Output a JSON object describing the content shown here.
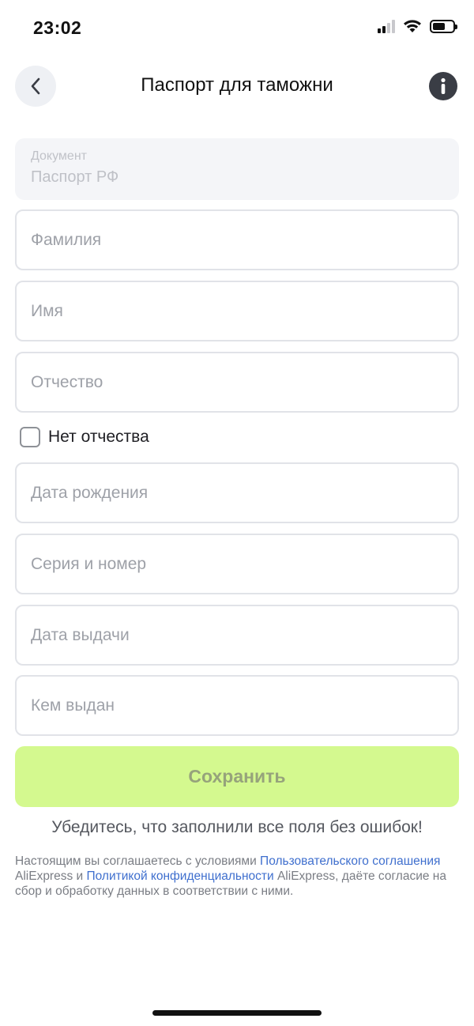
{
  "status_bar": {
    "time": "23:02",
    "signal_icon": "cellular-signal-icon",
    "wifi_icon": "wifi-icon",
    "battery_icon": "battery-icon"
  },
  "nav": {
    "title": "Паспорт для таможни",
    "back_icon": "chevron-left-icon",
    "info_icon": "info-icon"
  },
  "document": {
    "label": "Документ",
    "value": "Паспорт РФ"
  },
  "fields": {
    "last_name": {
      "placeholder": "Фамилия",
      "value": ""
    },
    "first_name": {
      "placeholder": "Имя",
      "value": ""
    },
    "patronymic": {
      "placeholder": "Отчество",
      "value": ""
    },
    "birth_date": {
      "placeholder": "Дата рождения",
      "value": ""
    },
    "series_number": {
      "placeholder": "Серия и номер",
      "value": ""
    },
    "issue_date": {
      "placeholder": "Дата выдачи",
      "value": ""
    },
    "issued_by": {
      "placeholder": "Кем выдан",
      "value": ""
    }
  },
  "no_patronymic": {
    "label": "Нет отчества",
    "checked": false
  },
  "save_button": {
    "label": "Сохранить"
  },
  "hint": "Убедитесь, что заполнили все поля без ошибок!",
  "legal": {
    "prefix": "Настоящим вы соглашаетесь с условиями ",
    "link1": "Пользовательского соглашения",
    "middle": " AliExpress и ",
    "link2": "Политикой конфиденциальности",
    "suffix": " AliExpress, даёте согласие на сбор и обработку данных в соответствии с ними."
  },
  "colors": {
    "accent_button": "#d4f98f",
    "link": "#3f6fce",
    "field_border": "#e1e3e8"
  }
}
